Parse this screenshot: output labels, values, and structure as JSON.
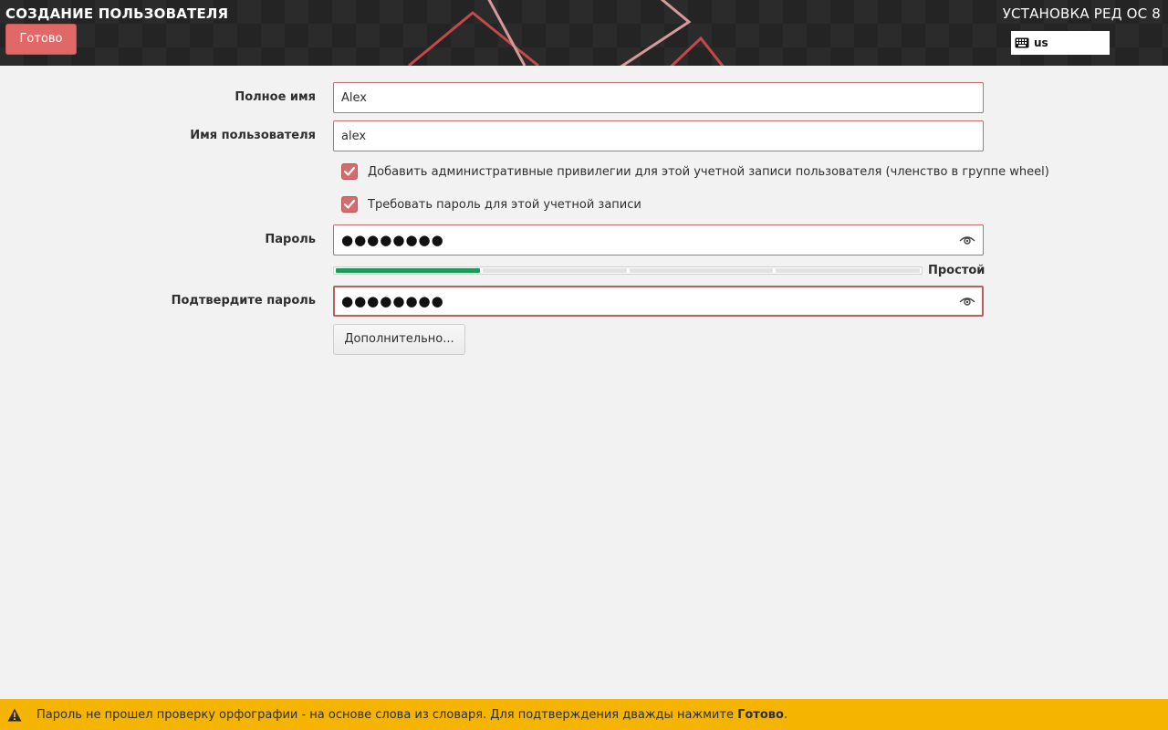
{
  "header": {
    "spoke_title": "СОЗДАНИЕ ПОЛЬЗОВАТЕЛЯ",
    "done_label": "Готово",
    "product_title": "УСТАНОВКА РЕД ОС 8",
    "keyboard_layout": "us",
    "keyboard_icon": "keyboard-icon"
  },
  "form": {
    "full_name_label": "Полное имя",
    "full_name_value": "Alex",
    "username_label": "Имя пользователя",
    "username_value": "alex",
    "admin_checkbox_label": "Добавить административные привилегии для этой учетной записи пользователя (членство в группе wheel)",
    "admin_checked": true,
    "require_password_label": "Требовать пароль для этой учетной записи",
    "require_password_checked": true,
    "password_label": "Пароль",
    "password_value": "●●●●●●●●",
    "strength_label": "Простой",
    "strength_level": 0.25,
    "confirm_label": "Подтвердите пароль",
    "confirm_value": "●●●●●●●●",
    "advanced_label": "Дополнительно...",
    "reveal_icon": "eye-icon"
  },
  "warning": {
    "icon": "warning-icon",
    "text_before": "Пароль не прошел проверку орфографии - на основе слова из словаря. Для подтверждения дважды нажмите ",
    "text_bold": "Готово",
    "text_after": "."
  },
  "colors": {
    "accent": "#e06868",
    "field_border": "#c66a6a",
    "strength_fill": "#1c9a5a",
    "warning_bg": "#f5b400",
    "header_bg": "#2b2b2b"
  }
}
